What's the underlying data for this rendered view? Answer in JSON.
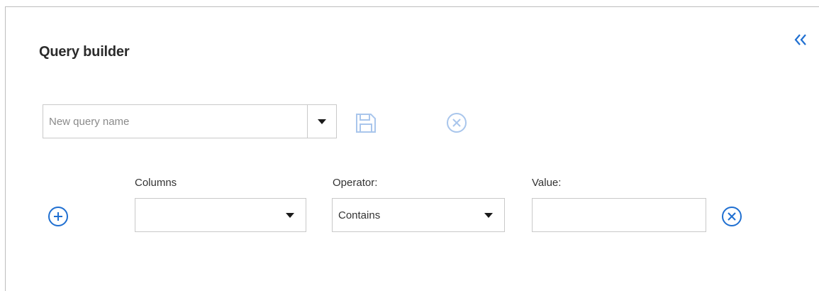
{
  "header": {
    "title": "Query builder",
    "collapse_icon": "double-chevron-left-icon"
  },
  "query": {
    "name_value": "",
    "name_placeholder": "New query name",
    "dropdown_icon": "caret-down-icon",
    "save_icon": "save-icon",
    "clear_icon": "close-circle-icon"
  },
  "condition_row": {
    "add_icon": "plus-circle-icon",
    "columns_label": "Columns",
    "columns_value": "",
    "operator_label": "Operator:",
    "operator_value": "Contains",
    "value_label": "Value:",
    "value_value": "",
    "remove_icon": "close-circle-icon"
  },
  "colors": {
    "accent": "#1f6fd1",
    "disabled_accent": "#a9c6ec",
    "border": "#c9c9c9",
    "text": "#333333"
  }
}
